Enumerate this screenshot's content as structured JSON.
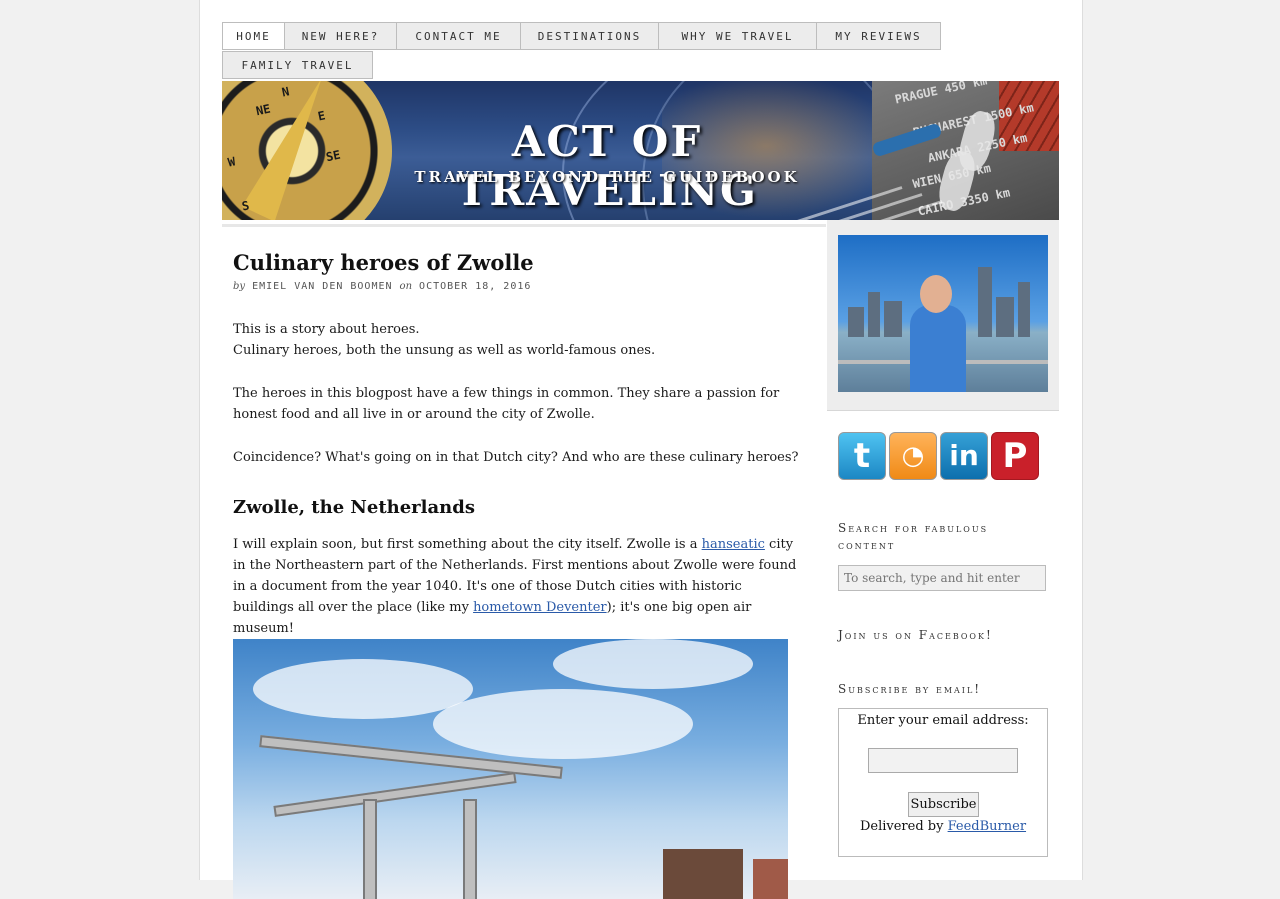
{
  "nav": {
    "tabs": [
      {
        "label": "Home"
      },
      {
        "label": "New here?"
      },
      {
        "label": "Contact me"
      },
      {
        "label": "Destinations"
      },
      {
        "label": "Why we travel"
      },
      {
        "label": "My reviews"
      },
      {
        "label": "Family travel"
      }
    ]
  },
  "header": {
    "title": "ACT OF TRAVELING",
    "subtitle": "TRAVEL BEYOND THE GUIDEBOOK",
    "stone_texts": [
      "PRAGUE 450 km",
      "BUCHAREST 1500 km",
      "ANKARA 2250 km",
      "WIEN 650 km",
      "CAIRO 3350 km"
    ],
    "compass_letters": [
      "N",
      "E",
      "SE",
      "S",
      "W",
      "NE"
    ]
  },
  "post": {
    "title": "Culinary heroes of Zwolle",
    "byline_by": "by",
    "author": "Emiel van den Boomen",
    "byline_on": "on",
    "date": "October 18, 2016",
    "p1_line1": "This is a story about heroes.",
    "p1_line2": "Culinary heroes, both the unsung as well as world-famous ones.",
    "p2": "The heroes in this blogpost have a few things in common. They share a passion for honest food and all live in or around the city of Zwolle.",
    "p3": "Coincidence? What's going on in that Dutch city? And who are these culinary heroes?",
    "h2": "Zwolle, the Netherlands",
    "p4_a": "I will explain soon, but first something about the city itself. Zwolle is a ",
    "p4_link1": "hanseatic",
    "p4_b": " city in the Northeastern part of the Netherlands. First mentions about Zwolle were found in a document from the year 1040. It's one of those Dutch cities with historic buildings all over the place (like my ",
    "p4_link2": "hometown Deventer",
    "p4_c": "); it's one big open air museum!"
  },
  "sidebar": {
    "social": [
      {
        "name": "twitter",
        "glyph": "t"
      },
      {
        "name": "rss",
        "glyph": "◔"
      },
      {
        "name": "linkedin",
        "glyph": "in"
      },
      {
        "name": "pinterest",
        "glyph": "P"
      }
    ],
    "search_title": "Search for fabulous content",
    "search_placeholder": "To search, type and hit enter",
    "facebook_title": "Join us on Facebook!",
    "subscribe_title": "Subscribe by email!",
    "subscribe_label": "Enter your email address:",
    "subscribe_button": "Subscribe",
    "delivered_by": "Delivered by ",
    "feedburner": "FeedBurner"
  },
  "colors": {
    "link": "#2a5aa8",
    "banner": "#2d4d86",
    "nav_tab_bg": "#ececec",
    "sidebar_grey": "#ededed"
  }
}
